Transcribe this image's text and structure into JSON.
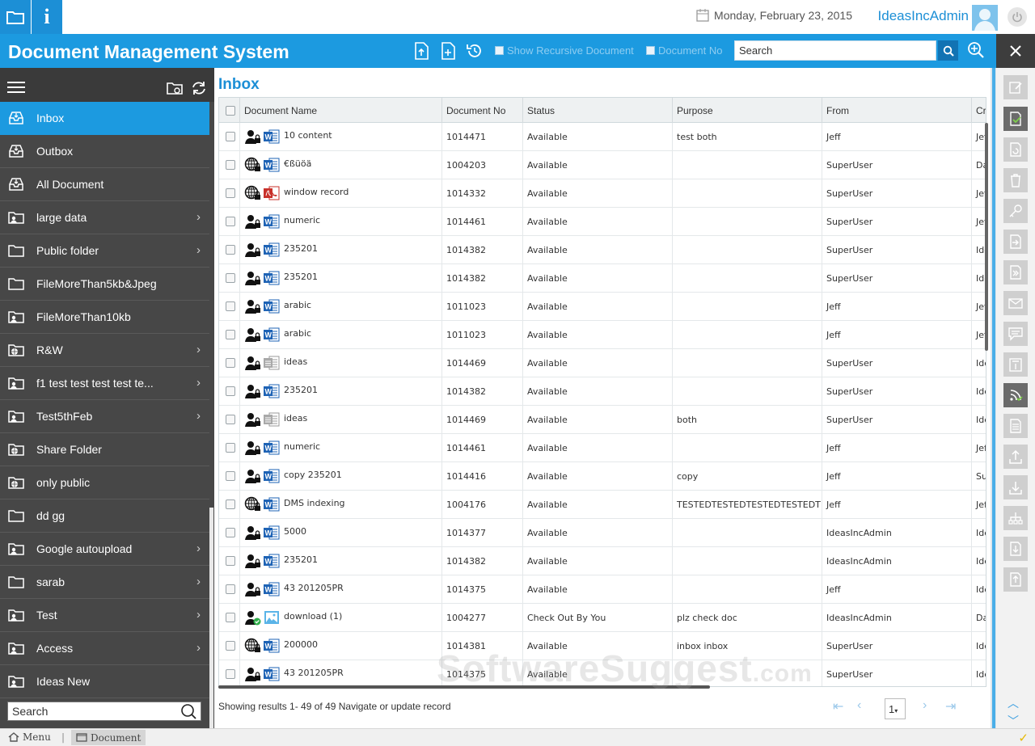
{
  "topbar": {
    "date": "Monday, February 23, 2015",
    "username": "IdeasIncAdmin",
    "info_label": "i"
  },
  "titlebar": {
    "title": "Document Management System",
    "show_recursive_label": "Show Recursive Document",
    "document_no_label": "Document No",
    "search_value": "Search"
  },
  "sidebar": {
    "items": [
      {
        "label": "Inbox",
        "icon": "inbox-icon",
        "active": true,
        "chevron": false
      },
      {
        "label": "Outbox",
        "icon": "inbox-icon",
        "chevron": false
      },
      {
        "label": "All Document",
        "icon": "inbox-icon",
        "chevron": false
      },
      {
        "label": "large data",
        "icon": "user-folder-icon",
        "chevron": true
      },
      {
        "label": "Public folder",
        "icon": "folder-icon",
        "chevron": true
      },
      {
        "label": "FileMoreThan5kb&Jpeg",
        "icon": "folder-icon",
        "chevron": false
      },
      {
        "label": "FileMoreThan10kb",
        "icon": "user-folder-icon",
        "chevron": false
      },
      {
        "label": "R&W",
        "icon": "globe-folder-icon",
        "chevron": true
      },
      {
        "label": "f1 test test test test te...",
        "icon": "user-folder-icon",
        "chevron": true
      },
      {
        "label": "Test5thFeb",
        "icon": "user-folder-icon",
        "chevron": true
      },
      {
        "label": "Share Folder",
        "icon": "globe-folder-icon",
        "chevron": false
      },
      {
        "label": "only public",
        "icon": "globe-folder-icon",
        "chevron": false
      },
      {
        "label": "dd gg",
        "icon": "folder-icon",
        "chevron": false
      },
      {
        "label": "Google autoupload",
        "icon": "user-folder-icon",
        "chevron": true
      },
      {
        "label": "sarab",
        "icon": "folder-icon",
        "chevron": true
      },
      {
        "label": "Test",
        "icon": "user-folder-icon",
        "chevron": true
      },
      {
        "label": "Access",
        "icon": "user-folder-icon",
        "chevron": true
      },
      {
        "label": "Ideas New",
        "icon": "user-folder-icon",
        "chevron": false
      }
    ],
    "search_value": "Search"
  },
  "main": {
    "title": "Inbox",
    "columns": [
      "Document Name",
      "Document No",
      "Status",
      "Purpose",
      "From",
      "Cre"
    ],
    "rows": [
      {
        "owner": "user",
        "type": "word",
        "name": "10 content",
        "no": "1014471",
        "status": "Available",
        "purpose": "test both",
        "from": "Jeff",
        "cre": "Jef"
      },
      {
        "owner": "globe",
        "type": "word",
        "name": "€ßüöä",
        "no": "1004203",
        "status": "Available",
        "purpose": "",
        "from": "SuperUser",
        "cre": "Da"
      },
      {
        "owner": "globe",
        "type": "pdf",
        "name": "window record",
        "no": "1014332",
        "status": "Available",
        "purpose": "",
        "from": "SuperUser",
        "cre": "Jef"
      },
      {
        "owner": "user",
        "type": "word",
        "name": "numeric",
        "no": "1014461",
        "status": "Available",
        "purpose": "",
        "from": "SuperUser",
        "cre": "Jef"
      },
      {
        "owner": "user",
        "type": "word",
        "name": "235201",
        "no": "1014382",
        "status": "Available",
        "purpose": "",
        "from": "SuperUser",
        "cre": "Ide"
      },
      {
        "owner": "user",
        "type": "word",
        "name": "235201",
        "no": "1014382",
        "status": "Available",
        "purpose": "",
        "from": "SuperUser",
        "cre": "Ide"
      },
      {
        "owner": "user",
        "type": "word",
        "name": "arabic",
        "no": "1011023",
        "status": "Available",
        "purpose": "",
        "from": "Jeff",
        "cre": "Jef"
      },
      {
        "owner": "user",
        "type": "word",
        "name": "arabic",
        "no": "1011023",
        "status": "Available",
        "purpose": "",
        "from": "Jeff",
        "cre": "Jef"
      },
      {
        "owner": "user",
        "type": "generic",
        "name": "ideas",
        "no": "1014469",
        "status": "Available",
        "purpose": "",
        "from": "SuperUser",
        "cre": "Ide"
      },
      {
        "owner": "user",
        "type": "word",
        "name": "235201",
        "no": "1014382",
        "status": "Available",
        "purpose": "",
        "from": "SuperUser",
        "cre": "Ide"
      },
      {
        "owner": "user",
        "type": "generic",
        "name": "ideas",
        "no": "1014469",
        "status": "Available",
        "purpose": "both",
        "from": "SuperUser",
        "cre": "Ide"
      },
      {
        "owner": "user",
        "type": "word",
        "name": "numeric",
        "no": "1014461",
        "status": "Available",
        "purpose": "",
        "from": "Jeff",
        "cre": "Jef"
      },
      {
        "owner": "user",
        "type": "word",
        "name": "copy 235201",
        "no": "1014416",
        "status": "Available",
        "purpose": "copy",
        "from": "Jeff",
        "cre": "Su"
      },
      {
        "owner": "globe",
        "type": "word",
        "name": "DMS indexing",
        "no": "1004176",
        "status": "Available",
        "purpose": "TESTEDTESTEDTESTEDTESTEDT",
        "from": "Jeff",
        "cre": "Jef"
      },
      {
        "owner": "user",
        "type": "word",
        "name": "5000",
        "no": "1014377",
        "status": "Available",
        "purpose": "",
        "from": "IdeasIncAdmin",
        "cre": "Ide"
      },
      {
        "owner": "user",
        "type": "word",
        "name": "235201",
        "no": "1014382",
        "status": "Available",
        "purpose": "",
        "from": "IdeasIncAdmin",
        "cre": "Ide"
      },
      {
        "owner": "user",
        "type": "word",
        "name": "43 201205PR",
        "no": "1014375",
        "status": "Available",
        "purpose": "",
        "from": "Jeff",
        "cre": "Ide"
      },
      {
        "owner": "user-check",
        "type": "image",
        "name": "download (1)",
        "no": "1004277",
        "status": "Check Out By You",
        "purpose": "plz check doc",
        "from": "IdeasIncAdmin",
        "cre": "Da"
      },
      {
        "owner": "globe",
        "type": "word",
        "name": "200000",
        "no": "1014381",
        "status": "Available",
        "purpose": "inbox inbox",
        "from": "SuperUser",
        "cre": "Ide"
      },
      {
        "owner": "user",
        "type": "word",
        "name": "43 201205PR",
        "no": "1014375",
        "status": "Available",
        "purpose": "",
        "from": "SuperUser",
        "cre": "Ide"
      }
    ],
    "footer": "Showing results 1- 49 of 49  Navigate or update record",
    "page": "1"
  },
  "bottombar": {
    "menu_label": "Menu",
    "document_label": "Document"
  },
  "watermark": {
    "main": "SoftwareSuggest",
    "suffix": ".com"
  },
  "colors": {
    "accent": "#1c9ae0",
    "sidebar": "#474747",
    "word_blue": "#1e63b5",
    "pdf_red": "#c8312b"
  }
}
